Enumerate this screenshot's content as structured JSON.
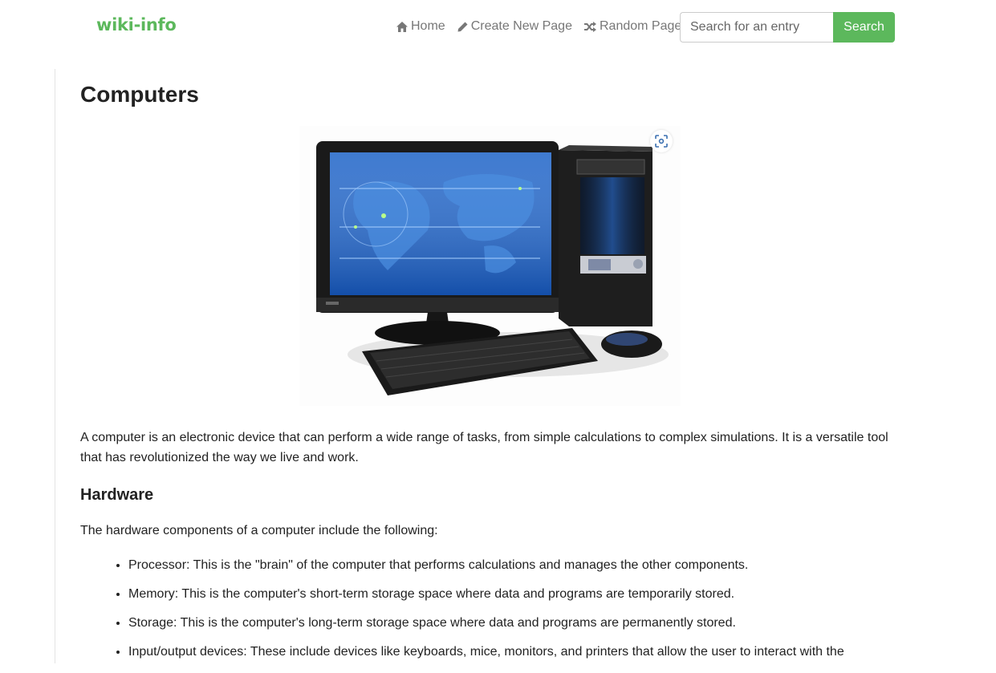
{
  "navbar": {
    "brand": "wiki-info",
    "links": [
      {
        "label": "Home",
        "icon": "home-icon"
      },
      {
        "label": "Create New Page",
        "icon": "pencil-icon"
      },
      {
        "label": "Random Page",
        "icon": "shuffle-icon"
      }
    ],
    "search": {
      "placeholder": "Search for an entry",
      "value": "",
      "button_label": "Search"
    }
  },
  "colors": {
    "accent": "#5cb85c",
    "nav_text": "#777777",
    "body_text": "#222222"
  },
  "article": {
    "title": "Computers",
    "image": {
      "subject": "desktop-computer-illustration",
      "zoom_icon": "zoom-scan-icon"
    },
    "intro": "A computer is an electronic device that can perform a wide range of tasks, from simple calculations to complex simulations. It is a versatile tool that has revolutionized the way we live and work.",
    "sections": [
      {
        "heading": "Hardware",
        "intro": "The hardware components of a computer include the following:",
        "items": [
          "Processor: This is the \"brain\" of the computer that performs calculations and manages the other components.",
          "Memory: This is the computer's short-term storage space where data and programs are temporarily stored.",
          "Storage: This is the computer's long-term storage space where data and programs are permanently stored.",
          "Input/output devices: These include devices like keyboards, mice, monitors, and printers that allow the user to interact with the"
        ]
      }
    ]
  }
}
